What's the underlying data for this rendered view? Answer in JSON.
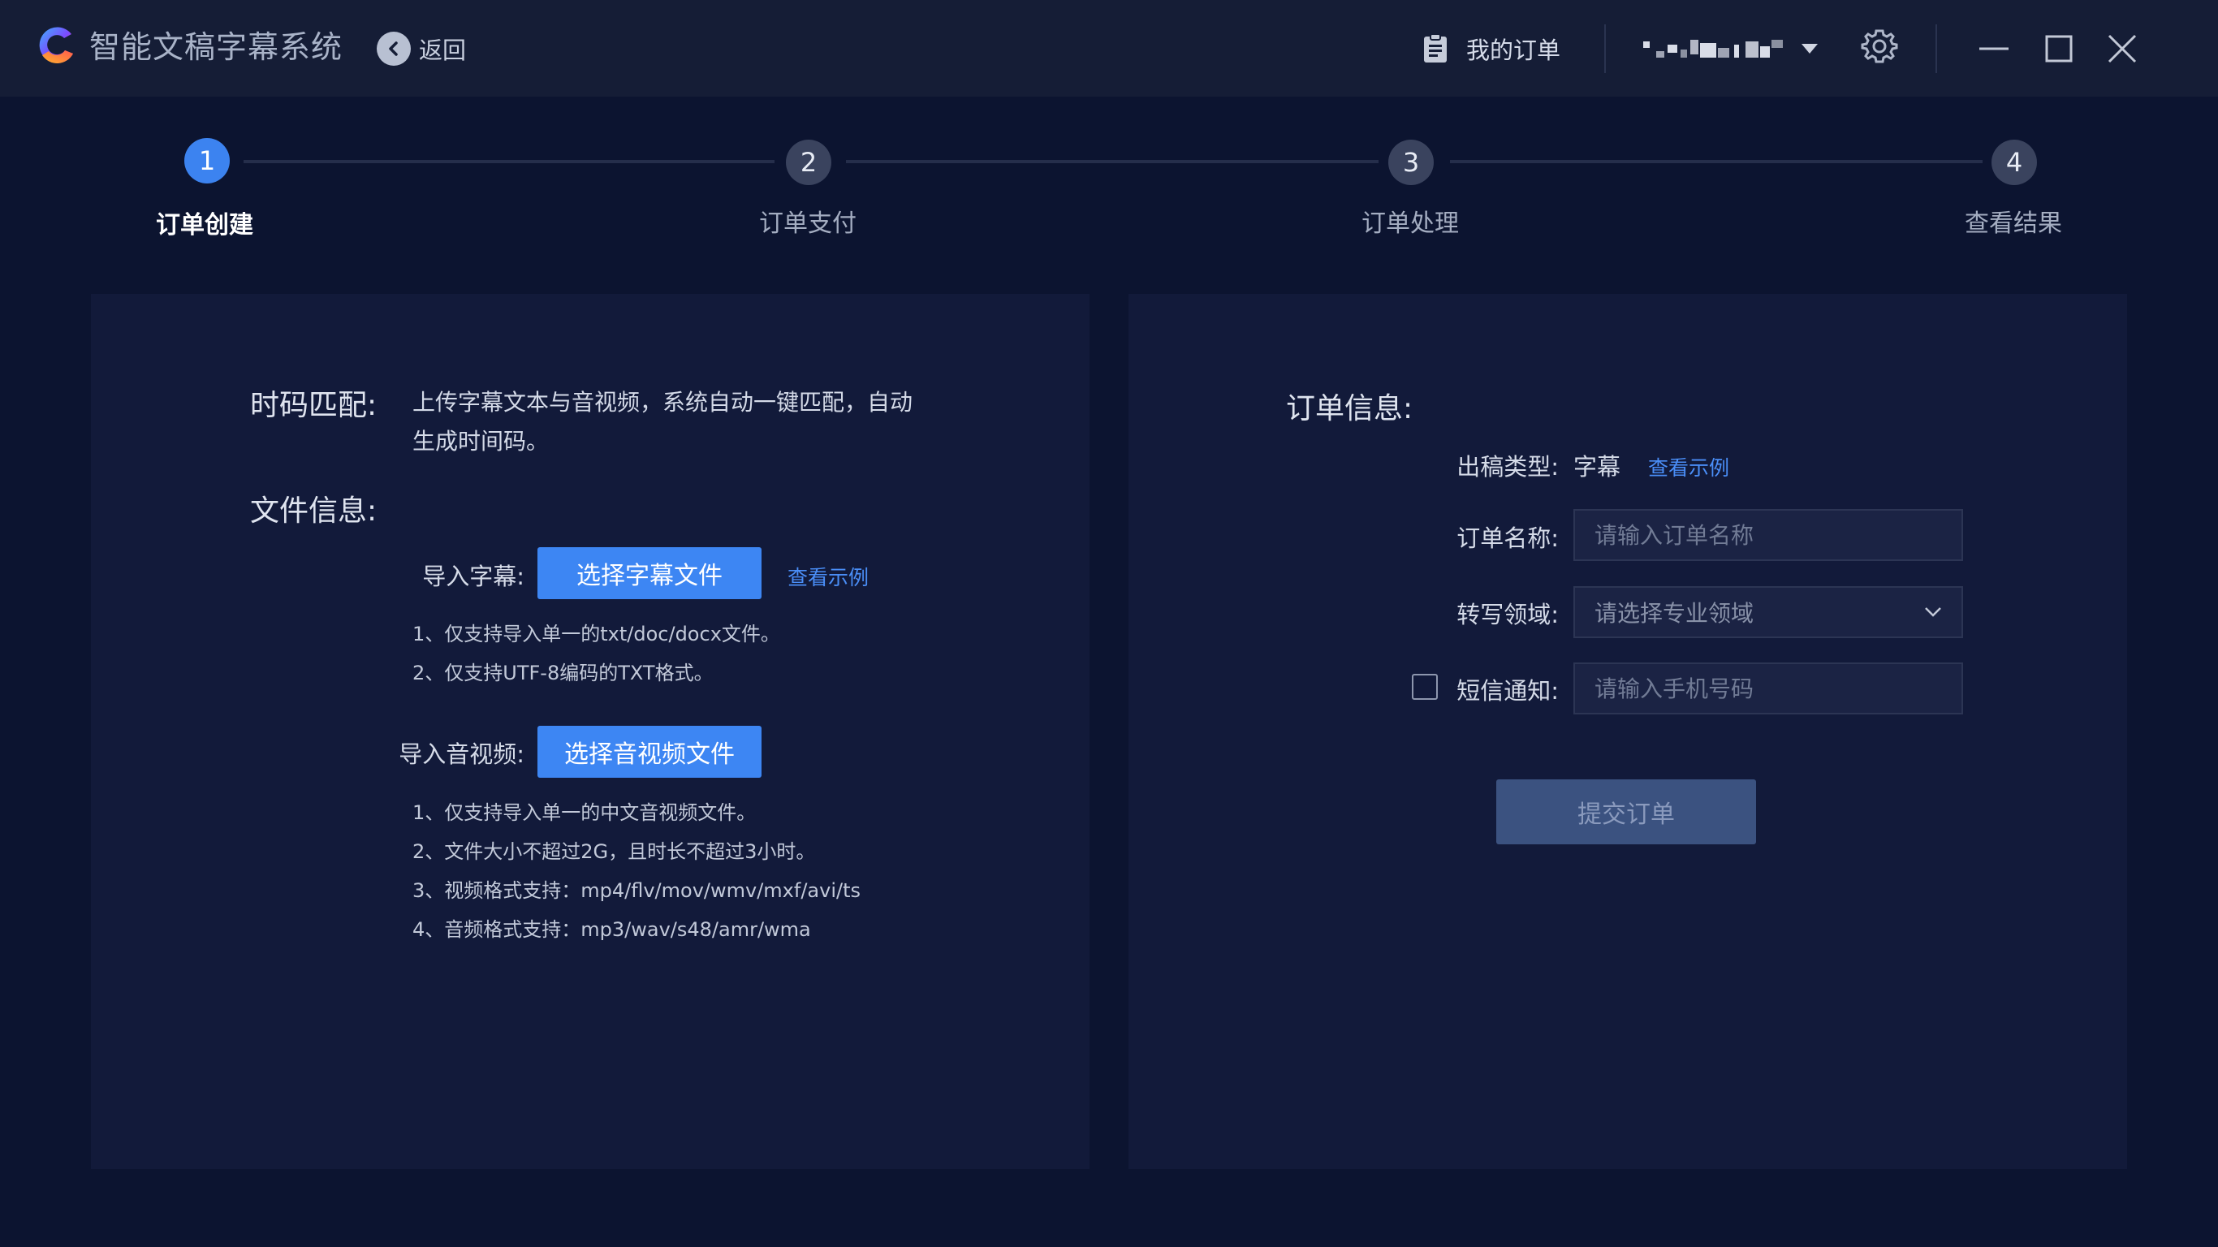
{
  "app": {
    "title": "智能文稿字幕系统",
    "back_label": "返回",
    "orders_label": "我的订单"
  },
  "steps": [
    {
      "num": "1",
      "label": "订单创建",
      "active": true
    },
    {
      "num": "2",
      "label": "订单支付",
      "active": false
    },
    {
      "num": "3",
      "label": "订单处理",
      "active": false
    },
    {
      "num": "4",
      "label": "查看结果",
      "active": false
    }
  ],
  "left": {
    "timecode_title": "时码匹配:",
    "timecode_desc_line1": "上传字幕文本与音视频，系统自动一键匹配，自动",
    "timecode_desc_line2": "生成时间码。",
    "fileinfo_title": "文件信息:",
    "subtitle_label": "导入字幕:",
    "subtitle_button": "选择字幕文件",
    "subtitle_example": "查看示例",
    "subtitle_notes": [
      "1、仅支持导入单一的txt/doc/docx文件。",
      "2、仅支持UTF-8编码的TXT格式。"
    ],
    "media_label": "导入音视频:",
    "media_button": "选择音视频文件",
    "media_notes": [
      "1、仅支持导入单一的中文音视频文件。",
      "2、文件大小不超过2G，且时长不超过3小时。",
      "3、视频格式支持：mp4/flv/mov/wmv/mxf/avi/ts",
      "4、音频格式支持：mp3/wav/s48/amr/wma"
    ]
  },
  "right": {
    "order_title": "订单信息:",
    "type_label": "出稿类型:",
    "type_value": "字幕",
    "type_example": "查看示例",
    "name_label": "订单名称:",
    "name_placeholder": "请输入订单名称",
    "domain_label": "转写领域:",
    "domain_placeholder": "请选择专业领域",
    "sms_label": "短信通知:",
    "sms_placeholder": "请输入手机号码",
    "submit_label": "提交订单"
  },
  "colors": {
    "background": "#0c1430",
    "titlebar": "#151d36",
    "panel": "#121a3a",
    "accent": "#3d86f3",
    "submit_disabled": "#3b5280"
  }
}
